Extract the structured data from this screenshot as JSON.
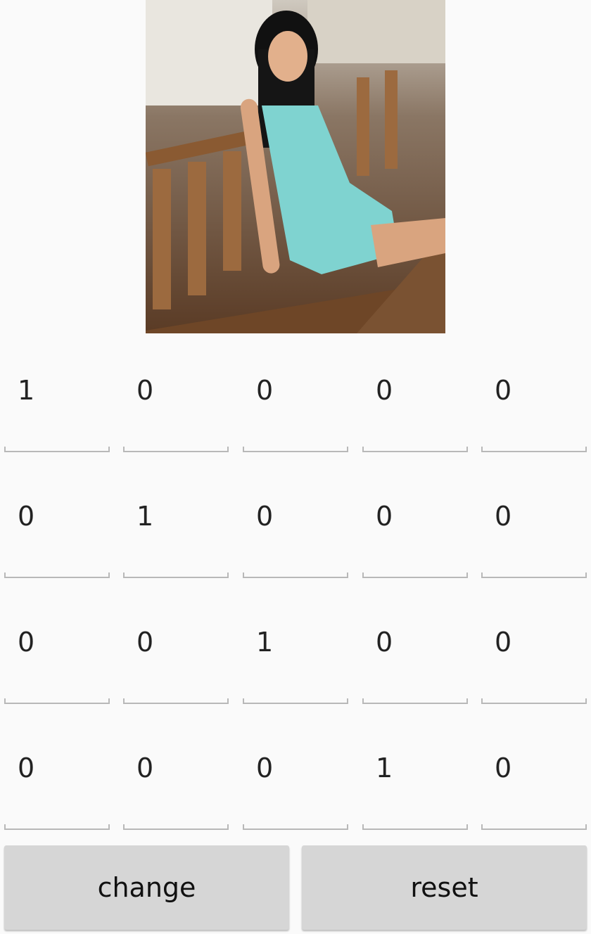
{
  "photo": {
    "description_icon": "photo-image"
  },
  "matrix": [
    [
      "1",
      "0",
      "0",
      "0",
      "0"
    ],
    [
      "0",
      "1",
      "0",
      "0",
      "0"
    ],
    [
      "0",
      "0",
      "1",
      "0",
      "0"
    ],
    [
      "0",
      "0",
      "0",
      "1",
      "0"
    ]
  ],
  "buttons": {
    "change_label": "change",
    "reset_label": "reset"
  },
  "colors": {
    "background": "#fafafa",
    "button_bg": "#d6d6d6",
    "underline": "#b8b8b8",
    "dress": "#7fd3d0"
  }
}
